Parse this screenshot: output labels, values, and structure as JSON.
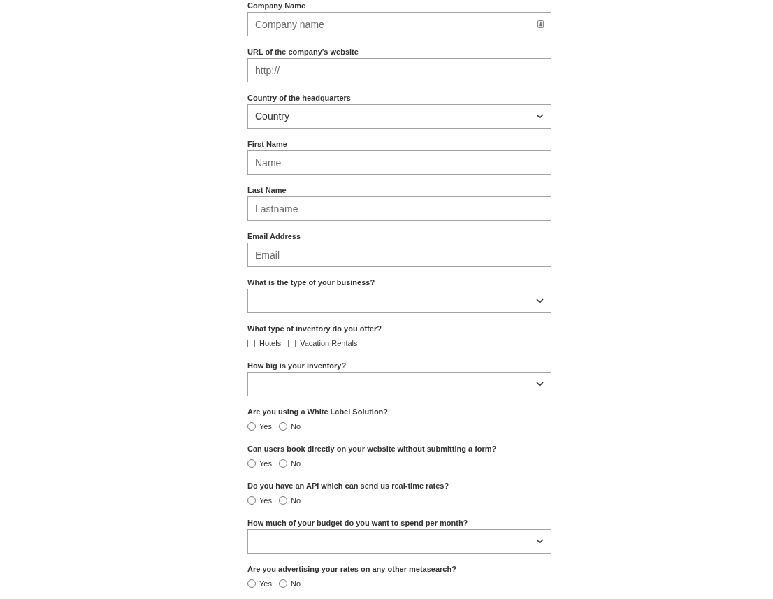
{
  "form": {
    "fields": [
      {
        "kind": "text",
        "label": "Company Name",
        "placeholder": "Company name",
        "autofill_icon": true
      },
      {
        "kind": "text",
        "label": "URL of the company's website",
        "placeholder": "http://"
      },
      {
        "kind": "select",
        "label": "Country of the headquarters",
        "value": "Country"
      },
      {
        "kind": "text",
        "label": "First Name",
        "placeholder": "Name"
      },
      {
        "kind": "text",
        "label": "Last Name",
        "placeholder": "Lastname"
      },
      {
        "kind": "text",
        "label": "Email Address",
        "placeholder": "Email"
      },
      {
        "kind": "select",
        "label": "What is the type of your business?"
      },
      {
        "kind": "checkboxes",
        "label": "What type of inventory do you offer?",
        "options": [
          {
            "label": "Hotels",
            "checked": false
          },
          {
            "label": "Vacation Rentals",
            "checked": false
          }
        ]
      },
      {
        "kind": "select",
        "label": "How big is your inventory?"
      },
      {
        "kind": "radio",
        "label": "Are you using a White Label Solution?",
        "options": [
          {
            "label": "Yes",
            "selected": false
          },
          {
            "label": "No",
            "selected": false
          }
        ]
      },
      {
        "kind": "radio",
        "label": "Can users book directly on your website without submitting a form?",
        "options": [
          {
            "label": "Yes",
            "selected": false
          },
          {
            "label": "No",
            "selected": false
          }
        ]
      },
      {
        "kind": "radio",
        "label": "Do you have an API which can send us real-time rates?",
        "options": [
          {
            "label": "Yes",
            "selected": false
          },
          {
            "label": "No",
            "selected": false
          }
        ]
      },
      {
        "kind": "select",
        "label": "How much of your budget do you want to spend per month?"
      },
      {
        "kind": "radio",
        "label": "Are you advertising your rates on any other metasearch?",
        "options": [
          {
            "label": "Yes",
            "selected": false
          },
          {
            "label": "No",
            "selected": false
          }
        ]
      }
    ]
  }
}
